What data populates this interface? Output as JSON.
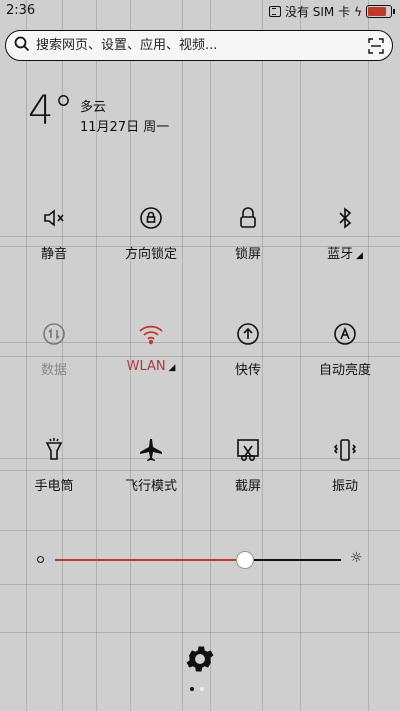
{
  "status": {
    "time": "2:36",
    "carrier_text": "没有 SIM 卡"
  },
  "search": {
    "placeholder": "搜索网页、设置、应用、视频..."
  },
  "weather": {
    "temperature": "4°",
    "condition": "多云",
    "date": "11月27日 周一"
  },
  "tiles": [
    {
      "label": "静音",
      "icon": "mute-icon"
    },
    {
      "label": "方向锁定",
      "icon": "rotation-lock-icon"
    },
    {
      "label": "锁屏",
      "icon": "lock-icon"
    },
    {
      "label": "蓝牙",
      "icon": "bluetooth-icon"
    },
    {
      "label": "数据",
      "icon": "data-icon"
    },
    {
      "label": "WLAN",
      "icon": "wifi-icon"
    },
    {
      "label": "快传",
      "icon": "transfer-icon"
    },
    {
      "label": "自动亮度",
      "icon": "auto-brightness-icon"
    },
    {
      "label": "手电筒",
      "icon": "flashlight-icon"
    },
    {
      "label": "飞行模式",
      "icon": "airplane-icon"
    },
    {
      "label": "截屏",
      "icon": "screenshot-icon"
    },
    {
      "label": "振动",
      "icon": "vibrate-icon"
    }
  ],
  "brightness": {
    "level_percent": 66
  },
  "colors": {
    "accent": "#c0392b",
    "background": "#cfcfcf"
  }
}
